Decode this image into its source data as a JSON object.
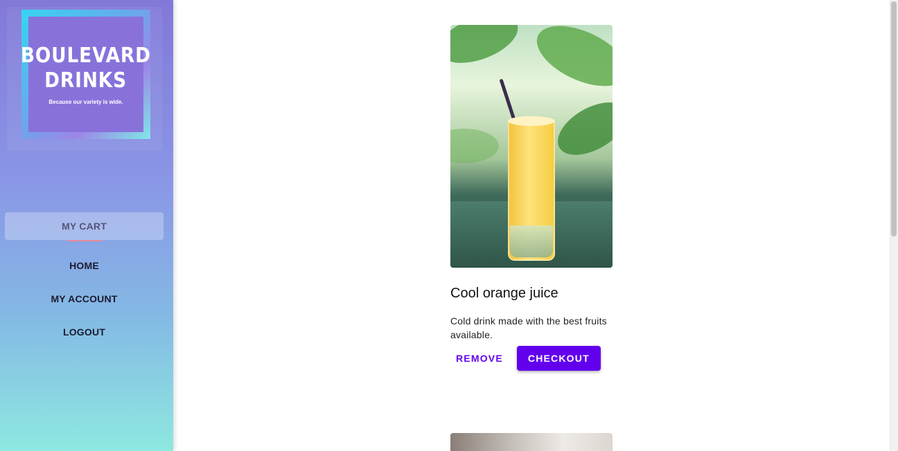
{
  "brand": {
    "logo_line1": "BOULEVARD",
    "logo_line2": "DRINKS",
    "logo_tagline": "Because our variety is wide."
  },
  "sidebar": {
    "items": [
      {
        "label": "MY CART",
        "active": true
      },
      {
        "label": "HOME",
        "active": false
      },
      {
        "label": "MY ACCOUNT",
        "active": false
      },
      {
        "label": "LOGOUT",
        "active": false
      }
    ]
  },
  "cart": {
    "items": [
      {
        "title": "Cool orange juice",
        "description": "Cold drink made with the best fruits available.",
        "remove_label": "REMOVE",
        "checkout_label": "CHECKOUT"
      }
    ]
  },
  "colors": {
    "accent": "#6200ee",
    "sidebar_top": "#8278d8",
    "sidebar_bottom": "#8ee8e0"
  }
}
